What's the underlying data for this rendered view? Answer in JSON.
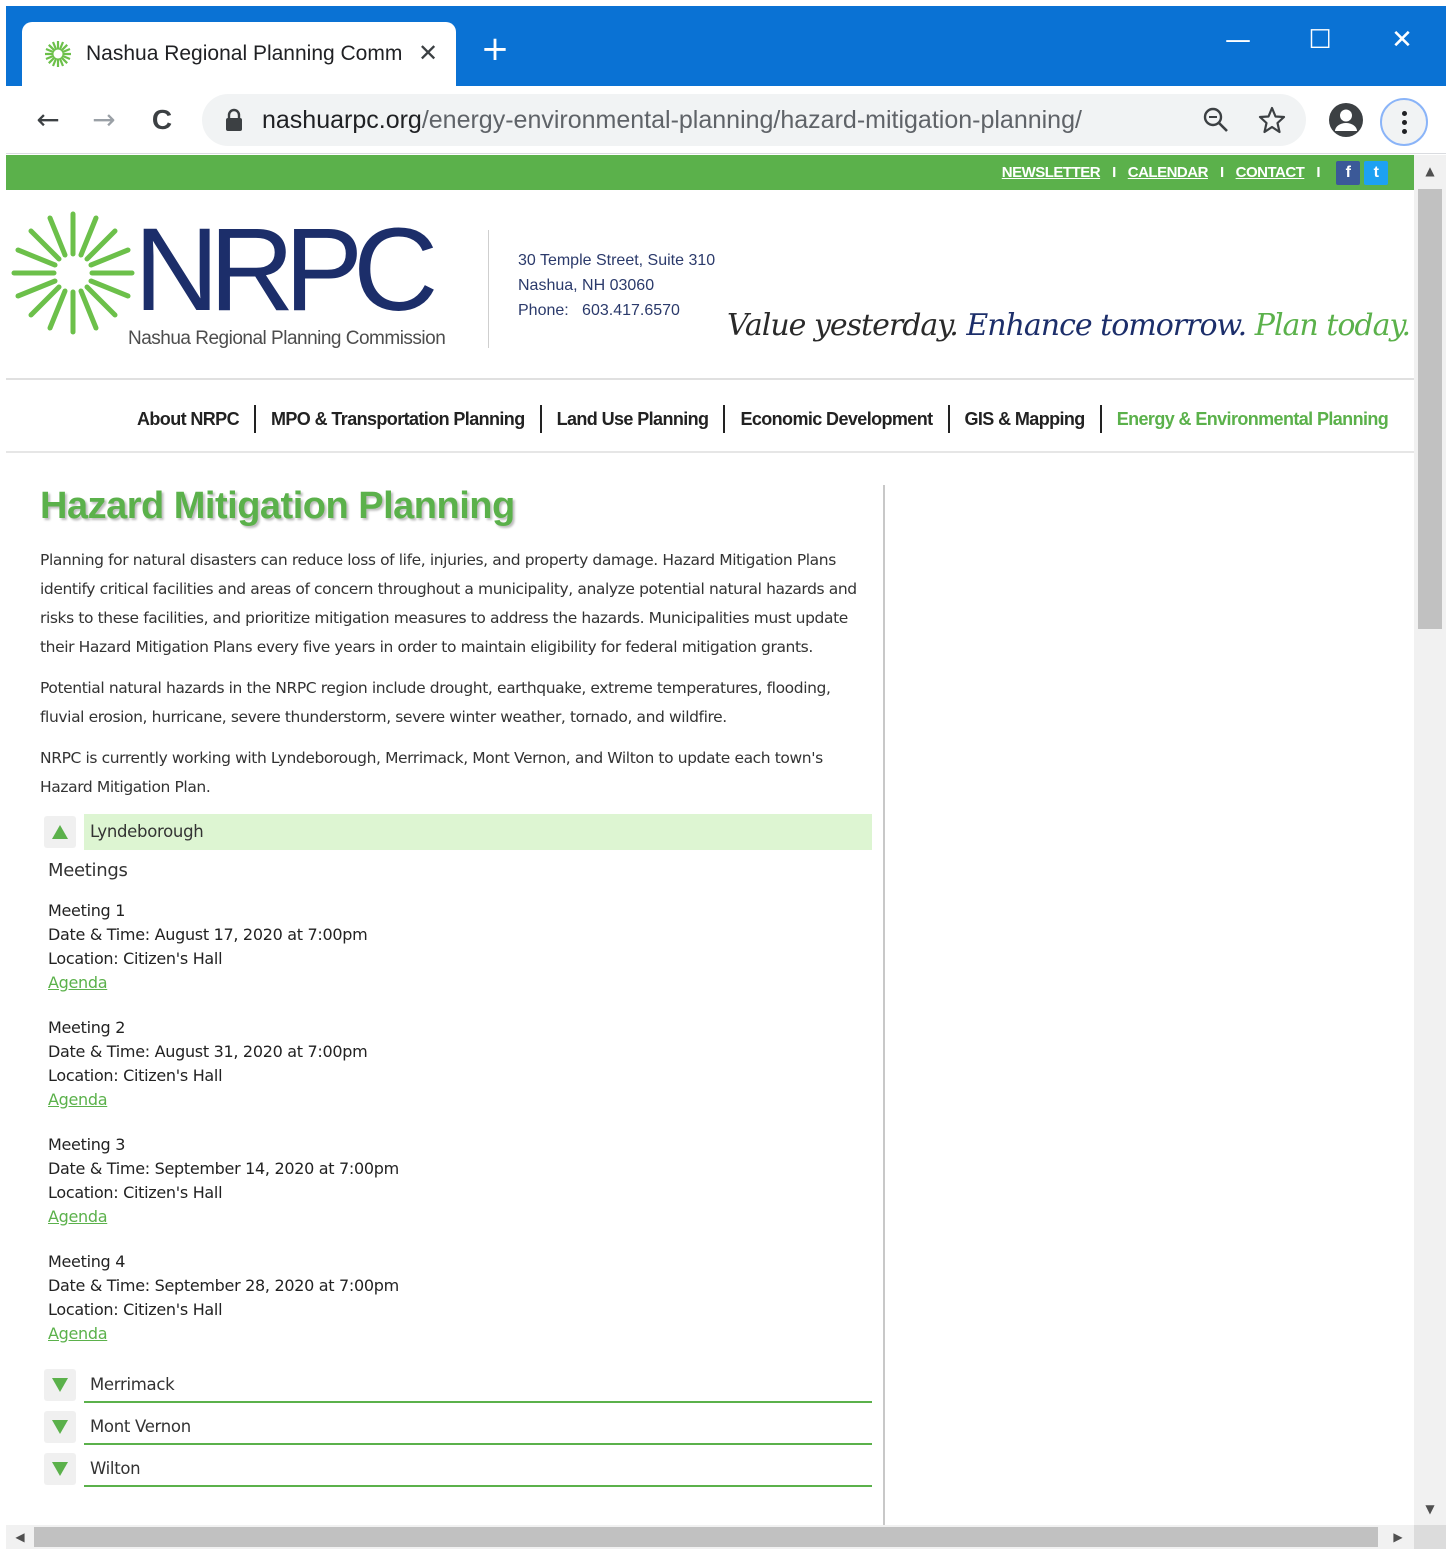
{
  "browser": {
    "tab_title": "Nashua Regional Planning Comm",
    "tab_close": "✕",
    "new_tab": "+",
    "url_host": "nashuarpc.org",
    "url_path": "/energy-environmental-planning/hazard-mitigation-planning/",
    "window_buttons": {
      "minimize": "—",
      "maximize": "☐",
      "close": "✕"
    },
    "nav": {
      "back": "←",
      "forward": "→",
      "reload": "C"
    },
    "icons": {
      "zoom": "zoom-icon",
      "star": "star-icon",
      "profile": "profile-icon",
      "menu": "kebab-menu-icon"
    }
  },
  "site": {
    "toplinks": [
      "NEWSLETTER",
      "CALENDAR",
      "CONTACT"
    ],
    "toplink_sep": "I",
    "social": {
      "facebook": "f",
      "twitter": "t"
    },
    "logo": {
      "mark": "NRPC",
      "subtitle": "Nashua Regional Planning Commission"
    },
    "address": {
      "line1": "30 Temple Street, Suite 310",
      "line2": "Nashua, NH 03060",
      "phone": "Phone:   603.417.6570"
    },
    "tagline": {
      "part1": "Value yesterday.",
      "part2": "Enhance tomorrow.",
      "part3": "Plan today."
    },
    "nav": [
      {
        "label": "About NRPC",
        "active": false
      },
      {
        "label": "MPO & Transportation Planning",
        "active": false
      },
      {
        "label": "Land Use Planning",
        "active": false
      },
      {
        "label": "Economic Development",
        "active": false
      },
      {
        "label": "GIS & Mapping",
        "active": false
      },
      {
        "label": "Energy & Environmental Planning",
        "active": true
      }
    ],
    "colors": {
      "brand_green": "#5bb14b",
      "brand_navy": "#1c2e6a",
      "chrome_blue": "#0a72d4"
    }
  },
  "main": {
    "title": "Hazard Mitigation Planning",
    "paragraphs": [
      "Planning for natural disasters can reduce loss of life, injuries, and property damage. Hazard Mitigation Plans identify critical facilities and areas of concern throughout a municipality, analyze potential natural hazards and risks to these facilities, and prioritize mitigation measures to address the hazards. Municipalities must update their Hazard Mitigation Plans every five years in order to maintain eligibility for federal mitigation grants.",
      "Potential natural hazards in the NRPC region include drought, earthquake, extreme temperatures, flooding, fluvial erosion, hurricane, severe thunderstorm, severe winter weather, tornado, and wildfire.",
      "NRPC is currently working with Lyndeborough, Merrimack, Mont Vernon, and Wilton to update each town's Hazard Mitigation Plan."
    ],
    "accordion": [
      {
        "label": "Lyndeborough",
        "open": true,
        "meetings_heading": "Meetings",
        "meetings": [
          {
            "name": "Meeting 1",
            "datetime": "Date & Time: August 17, 2020 at 7:00pm",
            "location": "Location: Citizen's Hall",
            "link": "Agenda"
          },
          {
            "name": "Meeting 2",
            "datetime": "Date & Time: August 31, 2020 at 7:00pm",
            "location": "Location: Citizen's Hall",
            "link": "Agenda"
          },
          {
            "name": "Meeting 3",
            "datetime": "Date & Time: September 14, 2020 at 7:00pm",
            "location": "Location: Citizen's Hall",
            "link": "Agenda"
          },
          {
            "name": "Meeting 4",
            "datetime": "Date & Time: September 28, 2020 at 7:00pm",
            "location": "Location: Citizen's Hall",
            "link": "Agenda"
          }
        ]
      },
      {
        "label": "Merrimack",
        "open": false
      },
      {
        "label": "Mont Vernon",
        "open": false
      },
      {
        "label": "Wilton",
        "open": false
      }
    ]
  }
}
